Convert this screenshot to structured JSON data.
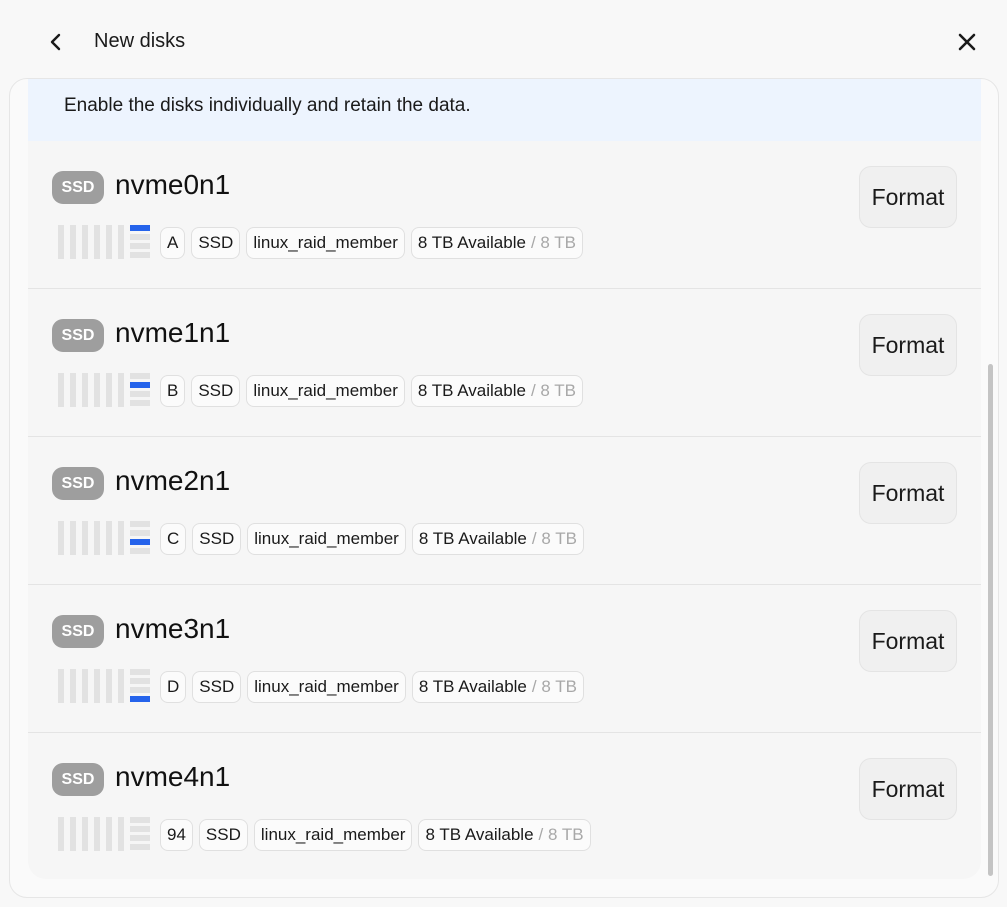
{
  "header": {
    "title": "New disks",
    "back_icon": "chevron-left-icon",
    "close_icon": "close-icon"
  },
  "notice": "Enable the disks individually and retain the data.",
  "disks": [
    {
      "badge": "SSD",
      "name": "nvme0n1",
      "slot": "A",
      "type": "SSD",
      "fs": "linux_raid_member",
      "available": "8 TB Available",
      "total": "/ 8 TB",
      "format_label": "Format",
      "active_slot_index": 0
    },
    {
      "badge": "SSD",
      "name": "nvme1n1",
      "slot": "B",
      "type": "SSD",
      "fs": "linux_raid_member",
      "available": "8 TB Available",
      "total": "/ 8 TB",
      "format_label": "Format",
      "active_slot_index": 1
    },
    {
      "badge": "SSD",
      "name": "nvme2n1",
      "slot": "C",
      "type": "SSD",
      "fs": "linux_raid_member",
      "available": "8 TB Available",
      "total": "/ 8 TB",
      "format_label": "Format",
      "active_slot_index": 2
    },
    {
      "badge": "SSD",
      "name": "nvme3n1",
      "slot": "D",
      "type": "SSD",
      "fs": "linux_raid_member",
      "available": "8 TB Available",
      "total": "/ 8 TB",
      "format_label": "Format",
      "active_slot_index": 3
    },
    {
      "badge": "SSD",
      "name": "nvme4n1",
      "slot": "94",
      "type": "SSD",
      "fs": "linux_raid_member",
      "available": "8 TB Available",
      "total": "/ 8 TB",
      "format_label": "Format",
      "active_slot_index": null
    }
  ],
  "colors": {
    "accent": "#2563eb",
    "notice_bg": "#edf4fe",
    "badge_bg": "#9e9e9e"
  }
}
